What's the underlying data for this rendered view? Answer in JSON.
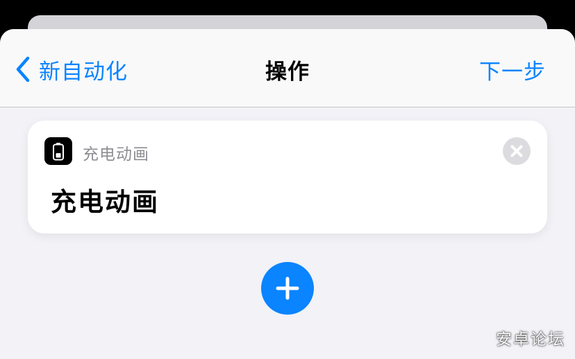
{
  "navbar": {
    "back_label": "新自动化",
    "title": "操作",
    "next_label": "下一步"
  },
  "action_card": {
    "app_name": "充电动画",
    "main_text": "充电动画",
    "app_icon": "battery-icon",
    "remove_icon": "close-icon"
  },
  "add_button": {
    "icon": "plus-icon"
  },
  "watermark": {
    "text": "安卓论坛"
  },
  "colors": {
    "accent": "#0a84ff",
    "background": "#f2f2f7",
    "card": "#ffffff",
    "secondary_text": "#8e8e93",
    "remove_button": "#dcdce0"
  }
}
